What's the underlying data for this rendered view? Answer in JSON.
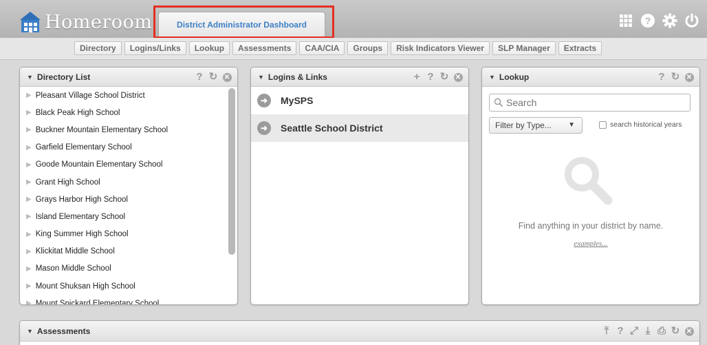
{
  "header": {
    "app_name": "Homeroom",
    "dashboard_tab": "District Administrator Dashboard"
  },
  "nav": {
    "tabs": [
      "Directory",
      "Logins/Links",
      "Lookup",
      "Assessments",
      "CAA/CIA",
      "Groups",
      "Risk Indicators Viewer",
      "SLP Manager",
      "Extracts"
    ]
  },
  "directory": {
    "title": "Directory List",
    "items": [
      "Pleasant Village School District",
      "Black Peak High School",
      "Buckner Mountain Elementary School",
      "Garfield Elementary School",
      "Goode Mountain Elementary School",
      "Grant High School",
      "Grays Harbor High School",
      "Island Elementary School",
      "King Summer High School",
      "Klickitat Middle School",
      "Mason Middle School",
      "Mount Shuksan High School",
      "Mount Spickard Elementary School"
    ]
  },
  "logins": {
    "title": "Logins & Links",
    "items": [
      "MySPS",
      "Seattle School District"
    ]
  },
  "lookup": {
    "title": "Lookup",
    "search_placeholder": "Search",
    "filter_label": "Filter by Type...",
    "historical_label": "search historical years",
    "empty_message": "Find anything in your district by name.",
    "examples_link": "examples..."
  },
  "assessments": {
    "title": "Assessments"
  },
  "colors": {
    "highlight": "#e32f21",
    "tab_text": "#3d7fc6"
  }
}
